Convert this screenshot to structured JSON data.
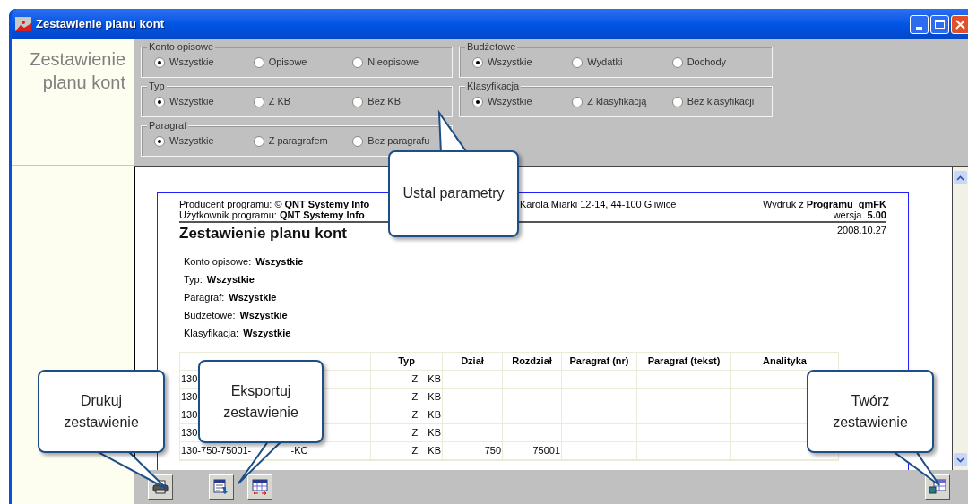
{
  "window": {
    "title": "Zestawienie planu kont"
  },
  "sidebar": {
    "title": "Zestawienie planu kont"
  },
  "filters_left": [
    {
      "label": "Konto opisowe",
      "options": [
        {
          "label": "Wszystkie",
          "selected": true
        },
        {
          "label": "Opisowe",
          "selected": false
        },
        {
          "label": "Nieopisowe",
          "selected": false
        }
      ]
    },
    {
      "label": "Typ",
      "options": [
        {
          "label": "Wszystkie",
          "selected": true
        },
        {
          "label": "Z KB",
          "selected": false
        },
        {
          "label": "Bez KB",
          "selected": false
        }
      ]
    },
    {
      "label": "Paragraf",
      "options": [
        {
          "label": "Wszystkie",
          "selected": true
        },
        {
          "label": "Z paragrafem",
          "selected": false
        },
        {
          "label": "Bez paragrafu",
          "selected": false
        }
      ]
    }
  ],
  "filters_right": [
    {
      "label": "Budżetowe",
      "options": [
        {
          "label": "Wszystkie",
          "selected": true
        },
        {
          "label": "Wydatki",
          "selected": false
        },
        {
          "label": "Dochody",
          "selected": false
        }
      ]
    },
    {
      "label": "Klasyfikacja",
      "options": [
        {
          "label": "Wszystkie",
          "selected": true
        },
        {
          "label": "Z klasyfikacją",
          "selected": false
        },
        {
          "label": "Bez klasyfikacji",
          "selected": false
        }
      ]
    }
  ],
  "report": {
    "producer": "Producent programu: © **QNT Systemy Info**",
    "user": "Użytkownik programu: **QNT Systemy Info**",
    "address": "Karola Miarki 12-14, 44-100 Gliwice",
    "print_info": "Wydruk z **Programu  qmFK**",
    "version": "wersja  **5.00**",
    "title": "Zestawienie planu kont",
    "date": "2008.10.27",
    "params": [
      {
        "label": "Konto opisowe:",
        "value": "Wszystkie"
      },
      {
        "label": "Typ:",
        "value": "Wszystkie"
      },
      {
        "label": "Paragraf:",
        "value": "Wszystkie"
      },
      {
        "label": "Budżetowe:",
        "value": "Wszystkie"
      },
      {
        "label": "Klasyfikacja:",
        "value": "Wszystkie"
      }
    ],
    "table": {
      "columns": [
        "",
        "Typ",
        "Dział",
        "Rozdział",
        "Paragraf (nr)",
        "Paragraf (tekst)",
        "Analityka"
      ],
      "rows": [
        [
          "130",
          "Z KB",
          "",
          "",
          "",
          "",
          ""
        ],
        [
          "130",
          "Z KB",
          "",
          "",
          "",
          "",
          ""
        ],
        [
          "130",
          "Z KB",
          "",
          "",
          "",
          "",
          ""
        ],
        [
          "130",
          "Z KB",
          "",
          "",
          "",
          "",
          ""
        ],
        [
          "130-750-75001-    -KC",
          "Z KB",
          "750",
          "75001",
          "",
          "",
          ""
        ]
      ]
    }
  },
  "toolbar": {
    "left": [
      {
        "kind": "print"
      },
      {
        "kind": "export"
      },
      {
        "kind": "columns"
      }
    ],
    "right": [
      {
        "kind": "create"
      }
    ]
  },
  "callouts": [
    "Ustal parametry",
    "Drukuj zestawienie",
    "Eksportuj zestawienie",
    "Twórz zestawienie"
  ]
}
